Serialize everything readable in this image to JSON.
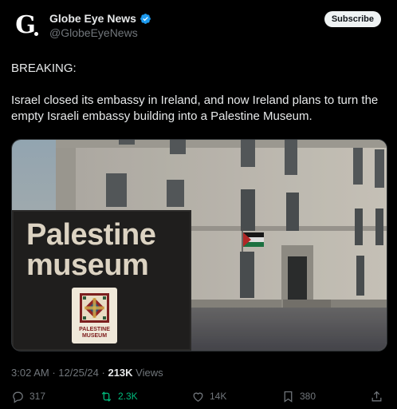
{
  "account": {
    "name": "Globe Eye News",
    "handle": "@GlobeEyeNews",
    "avatar_glyph": "G",
    "verified_color": "#1d9bf0",
    "subscribe_label": "Subscribe"
  },
  "post": {
    "breaking": "BREAKING:",
    "body": "Israel closed its embassy in Ireland, and now Ireland plans to turn the empty Israeli embassy building into a Palestine Museum."
  },
  "media": {
    "sign_text": "Palestine museum",
    "badge_line1": "PALESTINE",
    "badge_line2": "MUSEUM"
  },
  "meta": {
    "time": "3:02 AM",
    "date": "12/25/24",
    "views_count": "213K",
    "views_label": "Views"
  },
  "actions": {
    "replies": "317",
    "reposts": "2.3K",
    "likes": "14K",
    "bookmarks": "380",
    "icons": [
      "reply-icon",
      "repost-icon",
      "like-icon",
      "bookmark-icon",
      "share-icon"
    ],
    "repost_color": "#00ba7c"
  }
}
